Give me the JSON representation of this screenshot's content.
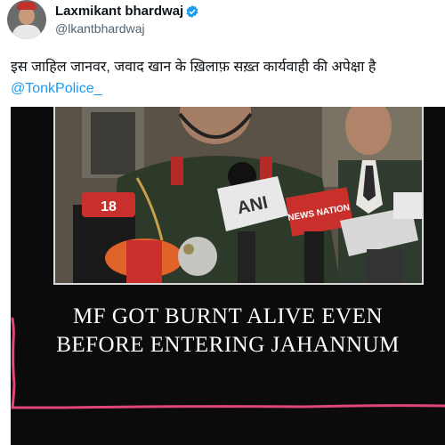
{
  "tweet": {
    "author_name": "Laxmikant bhardwaj",
    "author_handle": "@lkantbhardwaj",
    "text": "इस जाहिल जानवर,  जवाद खान के ख़िलाफ़ सख़्त कार्यवाही की अपेक्षा है ",
    "mention": "@TonkPolice_"
  },
  "media": {
    "mic_labels": [
      "18",
      "ANI",
      "NEWS NATION"
    ],
    "caption_line1": "MF GOT BURNT ALIVE EVEN",
    "caption_line2": "BEFORE ENTERING JAHANNUM"
  },
  "colors": {
    "verified": "#1d9bf0",
    "mention": "#1d9bf0",
    "scribble": "#e0457b"
  }
}
